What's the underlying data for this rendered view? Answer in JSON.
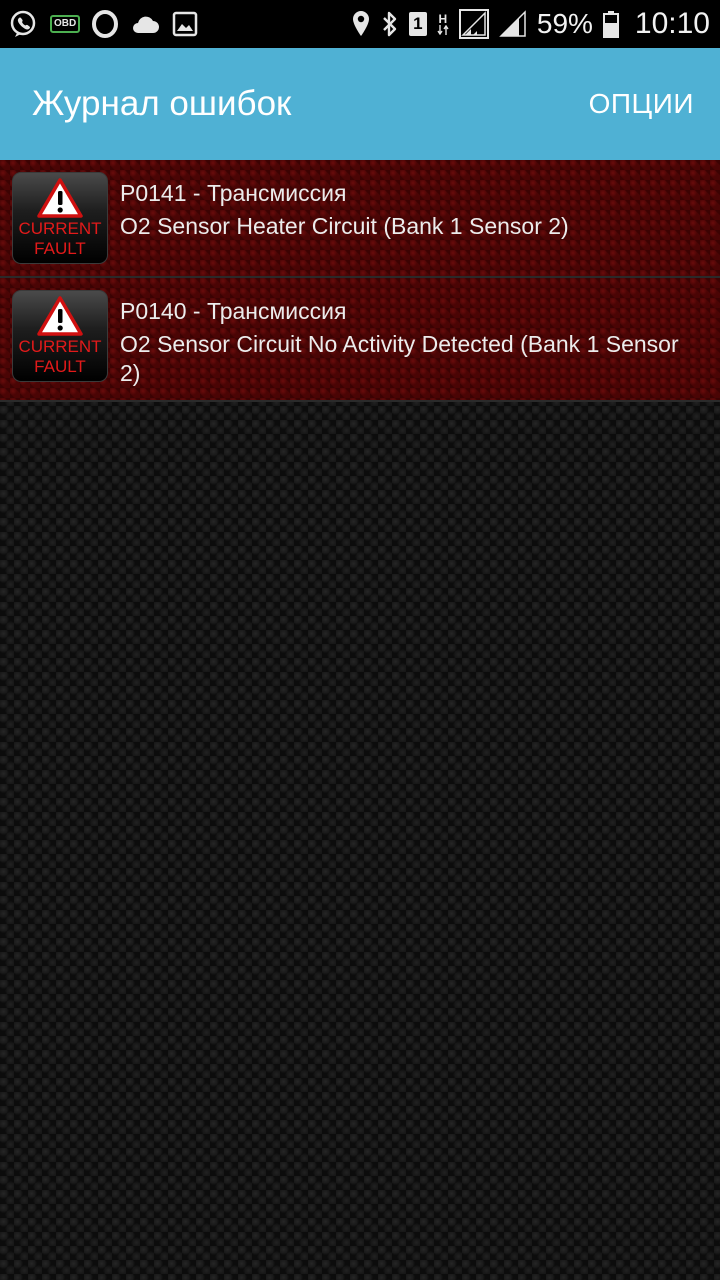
{
  "status_bar": {
    "left_icons": [
      "viber-icon",
      "obd-icon",
      "opera-icon",
      "cloud-icon",
      "image-icon"
    ],
    "obd_label": "OBD",
    "sim_label": "1",
    "network_label": "H",
    "battery_percent": "59%",
    "time": "10:10"
  },
  "app_bar": {
    "title": "Журнал ошибок",
    "options_label": "ОПЦИИ",
    "color": "#4fb1d4"
  },
  "faults": [
    {
      "code_line": "P0141 - Трансмиссия",
      "description": "O2 Sensor Heater Circuit (Bank 1 Sensor 2)",
      "badge_line1": "CURRENT",
      "badge_line2": "FAULT",
      "icon": "warning-triangle-icon"
    },
    {
      "code_line": "P0140 - Трансмиссия",
      "description": "O2 Sensor Circuit No Activity Detected (Bank 1 Sensor 2)",
      "badge_line1": "CURRENT",
      "badge_line2": "FAULT",
      "icon": "warning-triangle-icon"
    }
  ],
  "colors": {
    "fault_background": "#4a0505",
    "badge_text": "#e21a1a"
  }
}
